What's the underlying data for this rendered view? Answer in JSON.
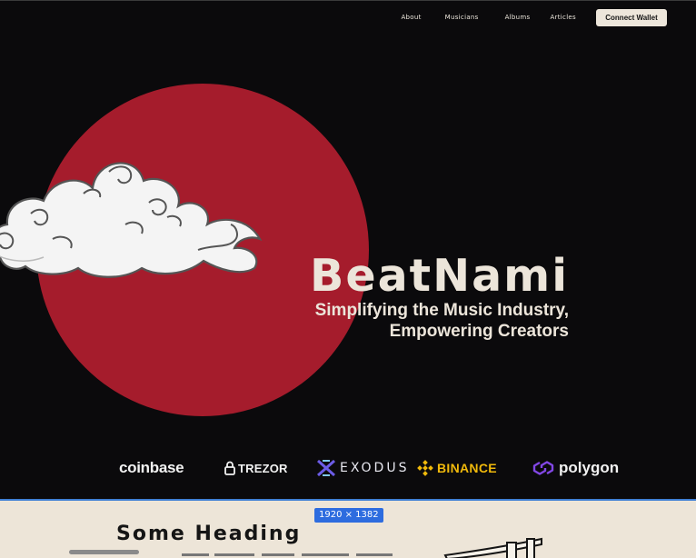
{
  "nav": {
    "links": [
      "About",
      "Musicians",
      "Albums",
      "Articles"
    ],
    "cta_label": "Connect Wallet"
  },
  "hero": {
    "brand": "BeatNami",
    "tagline_line1": "Simplifying the Music Industry,",
    "tagline_line2": "Empowering Creators"
  },
  "partners": [
    {
      "name": "coinbase",
      "icon": "coinbase-wordmark"
    },
    {
      "name": "TREZOR",
      "icon": "padlock-icon"
    },
    {
      "name": "EXODUS",
      "icon": "exodus-x-icon"
    },
    {
      "name": "BINANCE",
      "icon": "binance-diamond-icon"
    },
    {
      "name": "polygon",
      "icon": "polygon-chain-icon"
    }
  ],
  "section": {
    "heading": "Some Heading",
    "size_badge": "1920 × 1382"
  },
  "colors": {
    "background": "#0b0a0c",
    "sun": "#a51c2c",
    "cream": "#ede5d8",
    "binance_yellow": "#f0b90b",
    "polygon_purple": "#8247e5",
    "exodus_blue": "#6c5ce7",
    "badge_blue": "#2d6cdf"
  }
}
